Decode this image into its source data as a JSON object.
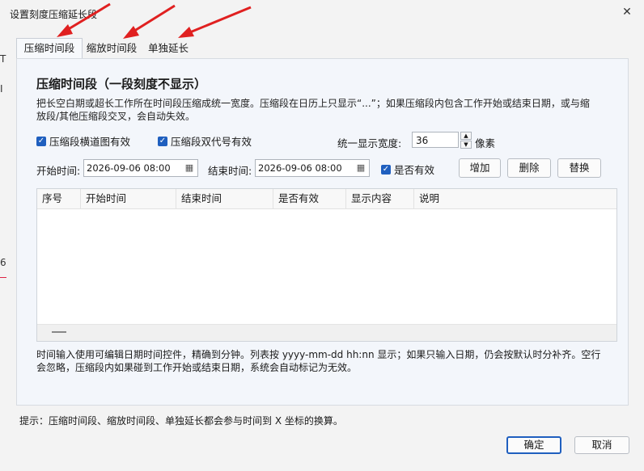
{
  "window": {
    "title": "设置刻度压缩延长段",
    "close_glyph": "✕"
  },
  "tabs": [
    {
      "label": "压缩时间段",
      "active": true
    },
    {
      "label": "缩放时间段",
      "active": false
    },
    {
      "label": "单独延长",
      "active": false
    }
  ],
  "panel": {
    "heading": "压缩时间段（一段刻度不显示）",
    "description": "把长空白期或超长工作所在时间段压缩成统一宽度。压缩段在日历上只显示“...”；如果压缩段内包含工作开始或结束日期，或与缩放段/其他压缩段交叉，会自动失效。",
    "checkbox1": {
      "label": "压缩段横道图有效",
      "checked": true
    },
    "checkbox2": {
      "label": "压缩段双代号有效",
      "checked": true
    },
    "width_label": "统一显示宽度:",
    "width_value": "36",
    "width_unit": "像素",
    "start_label": "开始时间:",
    "start_value": "2026-09-06 08:00",
    "end_label": "结束时间:",
    "end_value": "2026-09-06 08:00",
    "valid_checkbox": {
      "label": "是否有效",
      "checked": true
    },
    "buttons": {
      "add": "增加",
      "delete": "删除",
      "replace": "替换"
    },
    "table_columns": [
      "序号",
      "开始时间",
      "结束时间",
      "是否有效",
      "显示内容",
      "说明"
    ],
    "note": "时间输入使用可编辑日期时间控件，精确到分钟。列表按 yyyy-mm-dd hh:nn 显示；如果只输入日期，仍会按默认时分补齐。空行会忽略，压缩段内如果碰到工作开始或结束日期，系统会自动标记为无效。"
  },
  "footer": {
    "hint": "提示：压缩时间段、缩放时间段、单独延长都会参与时间到 X 坐标的换算。",
    "ok": "确定",
    "cancel": "取消"
  },
  "left_fragments": {
    "a": "T",
    "b": "I",
    "c": "6"
  },
  "colors": {
    "accent": "#1f5fbf",
    "arrow": "#e02020"
  },
  "icons": {
    "calendar": "calendar-icon",
    "check": "check-icon",
    "close": "close-icon"
  }
}
